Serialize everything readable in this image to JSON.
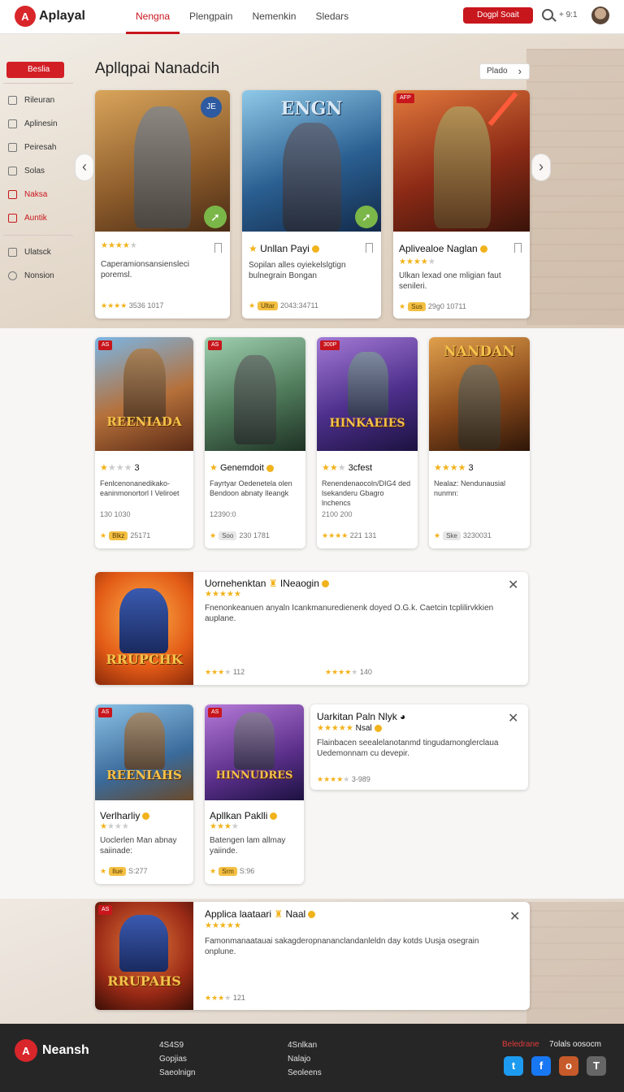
{
  "header": {
    "logo_mark": "A",
    "logo": "Aplayal",
    "nav": [
      "Nengna",
      "Plengpain",
      "Nemenkin",
      "Sledars"
    ],
    "cta": "Dogpl Soait",
    "count": "+ 9:1"
  },
  "sidebar": {
    "top_button": "Beslia",
    "items": [
      "Rileuran",
      "Aplinesin",
      "Peiresah",
      "Solas",
      "Naksa",
      "Auntik"
    ],
    "bottom": [
      "Ulatsck",
      "Nonsion"
    ]
  },
  "section": {
    "title": "Apllqpai Nanadcih",
    "view_all": "Plado"
  },
  "featured": [
    {
      "art_title": "",
      "corner": "JE",
      "title": "",
      "stars_on": 4,
      "desc": "Caperamionsansiensleci poremsl.",
      "meta": "3536 1017"
    },
    {
      "art_title": "ENGN",
      "corner": "",
      "title": "Unllan Payi",
      "stars_on": 0,
      "desc": "Sopilan alles oyiekelslgtign bulnegrain Bongan",
      "meta": "2043:34711",
      "pill": "Ultar"
    },
    {
      "art_title": "",
      "corner": "AFP",
      "title": "Aplivealoe Naglan",
      "stars_on": 4,
      "desc": "Ulkan lexad one mligian faut senileri.",
      "meta": "29g0 10711",
      "pill": "Sus"
    }
  ],
  "grid": [
    {
      "corner": "AS",
      "art_title": "REENIADA",
      "title": "",
      "rating": "3",
      "stars_on": 1,
      "desc": "Fenlcenonanedikako- eaninmonortorl I Veliroet",
      "line": "130 1030",
      "pill": "Blkz",
      "meta": "25171"
    },
    {
      "corner": "AS",
      "art_title": "",
      "title": "Genemdoit",
      "rating": "",
      "stars_on": 1,
      "desc": "Fayrtyar Oedenetela olen Bendoon abnaty Ileangk",
      "line": "12390:0",
      "pill": "Soo",
      "meta": "230 1781"
    },
    {
      "corner": "300P",
      "art_title": "HINKAEIES",
      "title": "",
      "rating": "3cfest",
      "stars_on": 2,
      "desc": "Renendenaocoln/DIG4 ded lsekanderu Gbagro lnchencs",
      "line": "2100 200",
      "pill": "",
      "meta": "221 131"
    },
    {
      "corner": "",
      "art_title": "NANDAN",
      "title": "",
      "rating": "3",
      "stars_on": 4,
      "desc": "Nealaz: Nendunausial nunmn:",
      "line": "",
      "pill": "Ske",
      "meta": "3230031"
    }
  ],
  "wide1": {
    "title": "Uornehenktan",
    "title2": "INeaogin",
    "art_title": "RRUPCHK",
    "desc": "Fnenonkeanuen anyaln Icankmanuredienenk doyed O.G.k. Caetcin tcplilirvkkien auplane.",
    "meta1": "112",
    "meta2": "140"
  },
  "small": [
    {
      "corner": "AS",
      "art_title": "REENIAHS",
      "title": "Verlharliy",
      "desc": "Uoclerlen Man abnay saiinade:",
      "pill": "Ilue",
      "meta": "S:277"
    },
    {
      "corner": "AS",
      "art_title": "HINNUDRES",
      "title": "Apllkan Paklli",
      "desc": "Batengen lam allmay yaiinde.",
      "pill": "Srm",
      "meta": "S:96"
    }
  ],
  "wide2": {
    "title": "Uarkitan Paln Nlyk",
    "sub": "Nsal",
    "desc": "Flainbacen seealelanotanmd tingudamonglerclaua Uedemonnam cu devepir.",
    "meta": "3-989"
  },
  "wide3": {
    "title": "Applica laataari",
    "title2": "Naal",
    "art_title": "RRUPAHS",
    "desc": "Famonmanaatauai sakagderopnananclandanleldn day kotds Uusja osegrain onplune.",
    "meta": "121"
  },
  "footer": {
    "logo_mark": "A",
    "logo": "Neansh",
    "col1": [
      "4S4S9",
      "Gopjias",
      "Saeolnign"
    ],
    "col2": [
      "4Snlkan",
      "Nalajo",
      "Seoleens"
    ],
    "red": "Beledrane",
    "white": "7olals oosocm",
    "social": [
      "t",
      "f",
      "o",
      "T"
    ]
  },
  "colors": {
    "accent": "#c8161d",
    "star": "#f3b21a",
    "twitter": "#1d9bf0",
    "facebook": "#1877f2",
    "ig": "#c75a2a",
    "other": "#666666"
  }
}
